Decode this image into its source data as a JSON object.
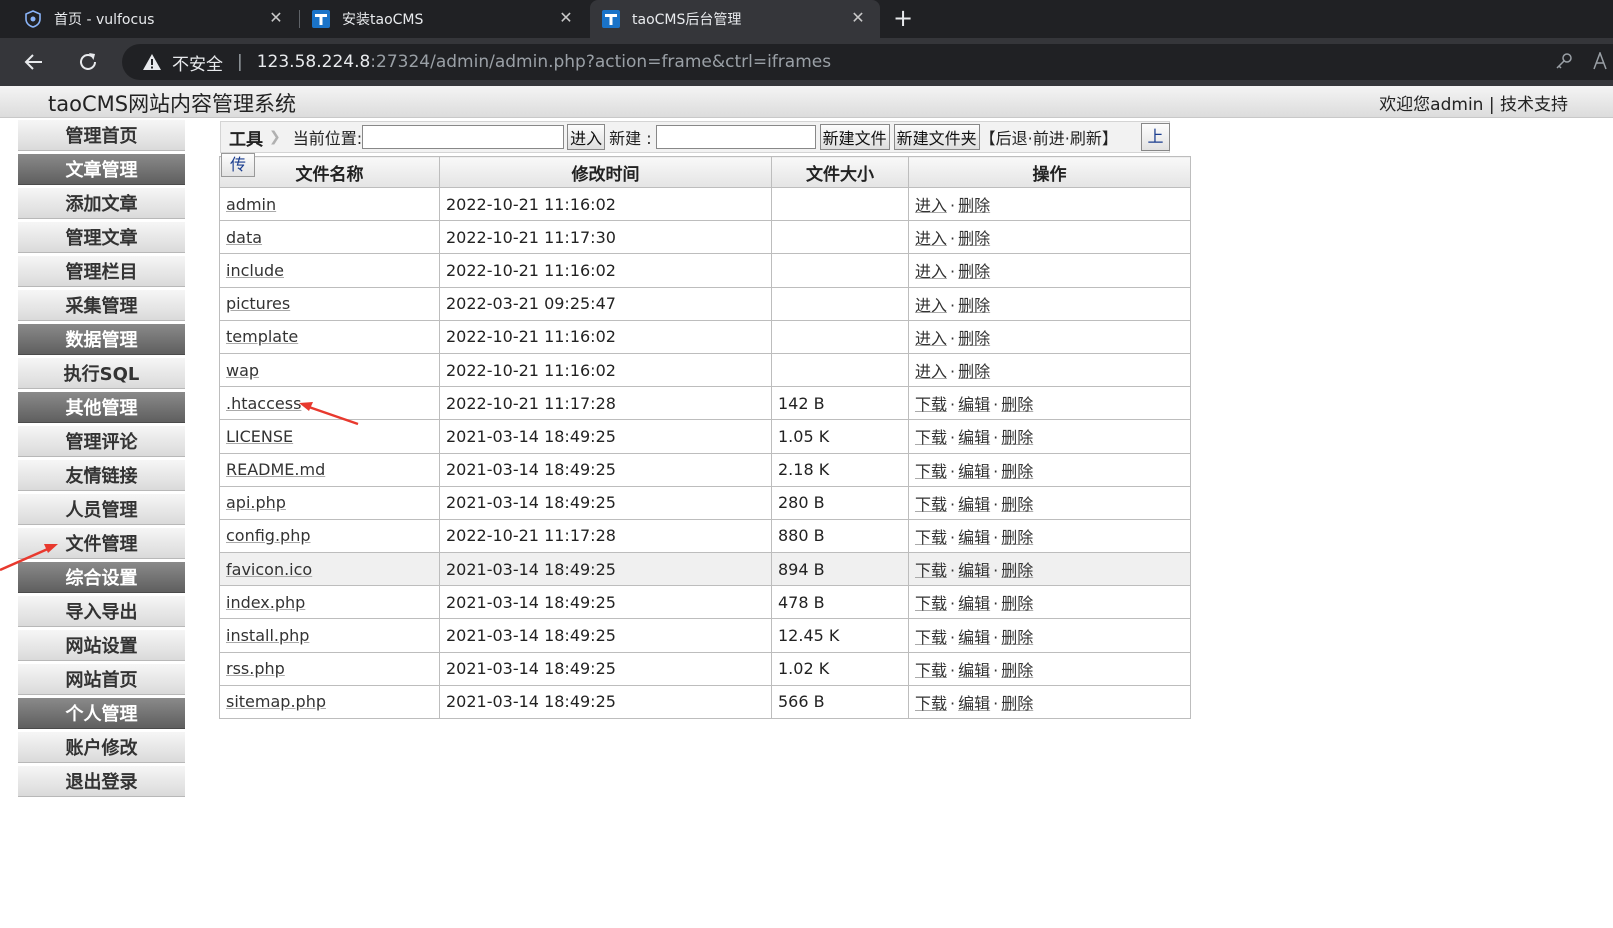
{
  "browser": {
    "tabs": [
      {
        "title": "首页 - vulfocus",
        "icon": "shield-icon"
      },
      {
        "title": "安装taoCMS",
        "icon": "taocms-icon"
      },
      {
        "title": "taoCMS后台管理",
        "icon": "taocms-icon"
      }
    ],
    "security_label": "不安全",
    "url_host": "123.58.224.8",
    "url_rest": ":27324/admin/admin.php?action=frame&ctrl=iframes"
  },
  "header": {
    "title": "taoCMS网站内容管理系统",
    "welcome": "欢迎您admin | 技术支持"
  },
  "sidebar": {
    "items": [
      {
        "label": "管理首页",
        "type": "item"
      },
      {
        "label": "文章管理",
        "type": "group"
      },
      {
        "label": "添加文章",
        "type": "item"
      },
      {
        "label": "管理文章",
        "type": "item"
      },
      {
        "label": "管理栏目",
        "type": "item"
      },
      {
        "label": "采集管理",
        "type": "item"
      },
      {
        "label": "数据管理",
        "type": "group"
      },
      {
        "label": "执行SQL",
        "type": "item"
      },
      {
        "label": "其他管理",
        "type": "group"
      },
      {
        "label": "管理评论",
        "type": "item"
      },
      {
        "label": "友情链接",
        "type": "item"
      },
      {
        "label": "人员管理",
        "type": "item"
      },
      {
        "label": "文件管理",
        "type": "item"
      },
      {
        "label": "综合设置",
        "type": "group"
      },
      {
        "label": "导入导出",
        "type": "item"
      },
      {
        "label": "网站设置",
        "type": "item"
      },
      {
        "label": "网站首页",
        "type": "item"
      },
      {
        "label": "个人管理",
        "type": "group"
      },
      {
        "label": "账户修改",
        "type": "item"
      },
      {
        "label": "退出登录",
        "type": "item"
      }
    ]
  },
  "toolbar": {
    "label": "工具",
    "location_label": "当前位置:",
    "location_value": "",
    "enter_button": "进入",
    "new_label": "新建 :",
    "new_value": "",
    "new_file_button": "新建文件",
    "new_folder_button": "新建文件夹",
    "history_links": "【后退·前进·刷新】",
    "upload_button_top": "上",
    "upload_button_bottom": "传"
  },
  "table": {
    "headers": [
      "文件名称",
      "修改时间",
      "文件大小",
      "操作"
    ],
    "rows": [
      {
        "name": "admin",
        "time": "2022-10-21 11:16:02",
        "size": "",
        "ops": [
          "进入",
          "删除"
        ]
      },
      {
        "name": "data",
        "time": "2022-10-21 11:17:30",
        "size": "",
        "ops": [
          "进入",
          "删除"
        ]
      },
      {
        "name": "include",
        "time": "2022-10-21 11:16:02",
        "size": "",
        "ops": [
          "进入",
          "删除"
        ]
      },
      {
        "name": "pictures",
        "time": "2022-03-21 09:25:47",
        "size": "",
        "ops": [
          "进入",
          "删除"
        ]
      },
      {
        "name": "template",
        "time": "2022-10-21 11:16:02",
        "size": "",
        "ops": [
          "进入",
          "删除"
        ]
      },
      {
        "name": "wap",
        "time": "2022-10-21 11:16:02",
        "size": "",
        "ops": [
          "进入",
          "删除"
        ]
      },
      {
        "name": ".htaccess",
        "time": "2022-10-21 11:17:28",
        "size": "142 B",
        "ops": [
          "下载",
          "编辑",
          "删除"
        ]
      },
      {
        "name": "LICENSE",
        "time": "2021-03-14 18:49:25",
        "size": "1.05 K",
        "ops": [
          "下载",
          "编辑",
          "删除"
        ]
      },
      {
        "name": "README.md",
        "time": "2021-03-14 18:49:25",
        "size": "2.18 K",
        "ops": [
          "下载",
          "编辑",
          "删除"
        ]
      },
      {
        "name": "api.php",
        "time": "2021-03-14 18:49:25",
        "size": "280 B",
        "ops": [
          "下载",
          "编辑",
          "删除"
        ]
      },
      {
        "name": "config.php",
        "time": "2022-10-21 11:17:28",
        "size": "880 B",
        "ops": [
          "下载",
          "编辑",
          "删除"
        ]
      },
      {
        "name": "favicon.ico",
        "time": "2021-03-14 18:49:25",
        "size": "894 B",
        "ops": [
          "下载",
          "编辑",
          "删除"
        ],
        "highlight": true
      },
      {
        "name": "index.php",
        "time": "2021-03-14 18:49:25",
        "size": "478 B",
        "ops": [
          "下载",
          "编辑",
          "删除"
        ]
      },
      {
        "name": "install.php",
        "time": "2021-03-14 18:49:25",
        "size": "12.45 K",
        "ops": [
          "下载",
          "编辑",
          "删除"
        ]
      },
      {
        "name": "rss.php",
        "time": "2021-03-14 18:49:25",
        "size": "1.02 K",
        "ops": [
          "下载",
          "编辑",
          "删除"
        ]
      },
      {
        "name": "sitemap.php",
        "time": "2021-03-14 18:49:25",
        "size": "566 B",
        "ops": [
          "下载",
          "编辑",
          "删除"
        ]
      }
    ]
  },
  "colors": {
    "annotation_arrow": "#e8392e",
    "group_item": "#6e6e6e"
  }
}
